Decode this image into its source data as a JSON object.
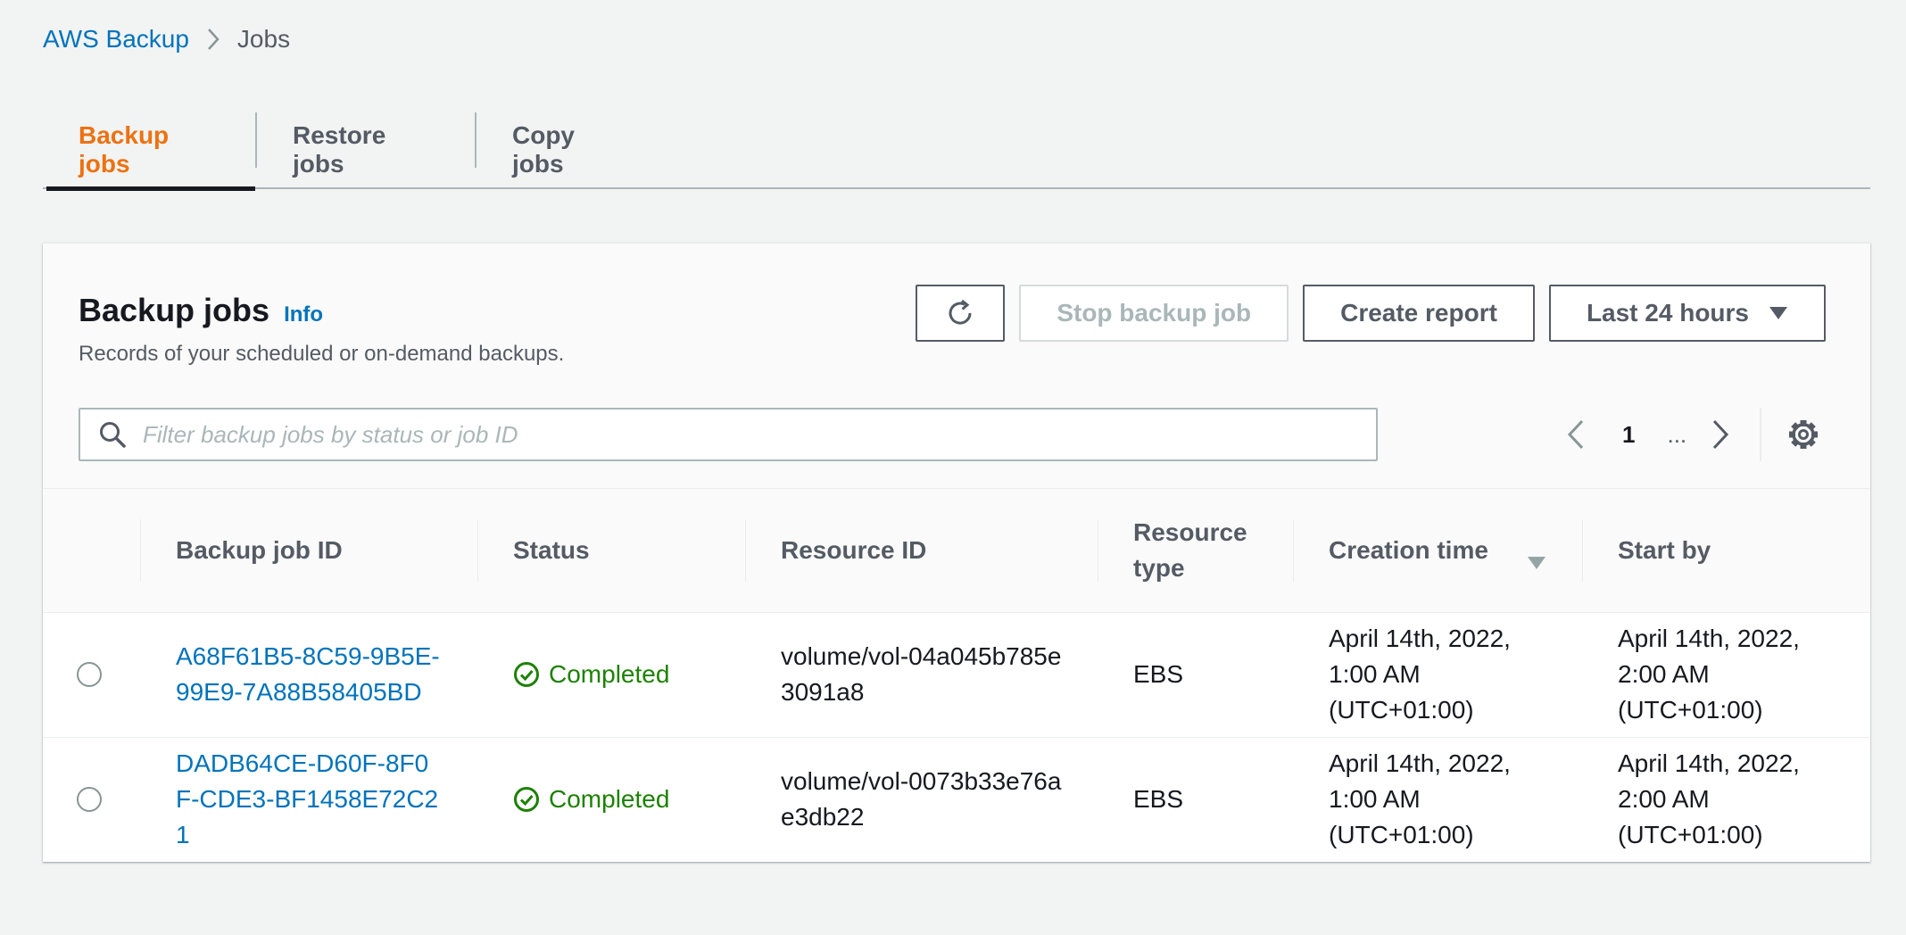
{
  "breadcrumb": {
    "root": "AWS Backup",
    "current": "Jobs"
  },
  "tabs": [
    {
      "label": "Backup jobs",
      "active": true
    },
    {
      "label": "Restore jobs",
      "active": false
    },
    {
      "label": "Copy jobs",
      "active": false
    }
  ],
  "panel": {
    "title": "Backup jobs",
    "info": "Info",
    "description": "Records of your scheduled or on-demand backups.",
    "buttons": {
      "refresh_icon": "refresh-icon",
      "stop": "Stop backup job",
      "create_report": "Create report",
      "time_range": "Last 24 hours"
    },
    "search_placeholder": "Filter backup jobs by status or job ID",
    "pagination": {
      "current_page": "1",
      "ellipsis": "..."
    }
  },
  "table": {
    "columns": [
      "Backup job ID",
      "Status",
      "Resource ID",
      "Resource type",
      "Creation time",
      "Start by"
    ],
    "rows": [
      {
        "job_id": "A68F61B5-8C59-9B5E-99E9-7A88B58405BD",
        "status": "Completed",
        "resource_id": "volume/vol-04a045b785e3091a8",
        "resource_type": "EBS",
        "creation_time": "April 14th, 2022, 1:00 AM (UTC+01:00)",
        "start_by": "April 14th, 2022, 2:00 AM (UTC+01:00)"
      },
      {
        "job_id": "DADB64CE-D60F-8F0F-CDE3-BF1458E72C21",
        "status": "Completed",
        "resource_id": "volume/vol-0073b33e76ae3db22",
        "resource_type": "EBS",
        "creation_time": "April 14th, 2022, 1:00 AM (UTC+01:00)",
        "start_by": "April 14th, 2022, 2:00 AM (UTC+01:00)"
      }
    ]
  },
  "colors": {
    "link": "#0073bb",
    "active_tab": "#ec7211",
    "success": "#1d8102",
    "background": "#f2f3f3"
  }
}
